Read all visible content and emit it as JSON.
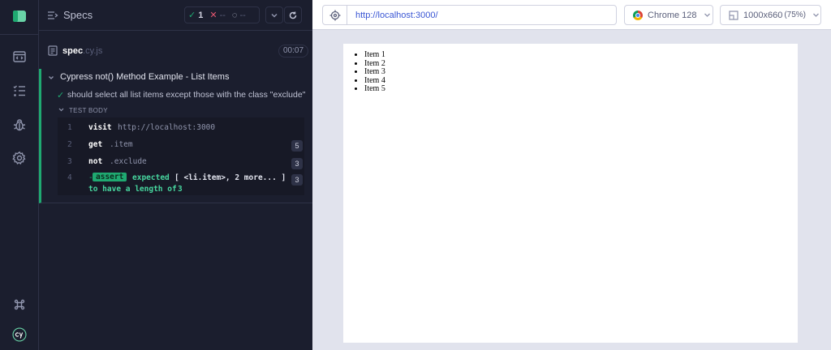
{
  "rail": {
    "items": [
      "specs-nav",
      "runs-nav",
      "debug-nav",
      "settings-nav"
    ]
  },
  "header": {
    "title": "Specs",
    "passed": "1",
    "failed": "--",
    "pending": "--"
  },
  "spec": {
    "name": "spec",
    "ext": ".cy.js",
    "duration": "00:07"
  },
  "suite": {
    "title": "Cypress not() Method Example - List Items",
    "test_title": "should select all list items except those with the class \"exclude\"",
    "body_label": "TEST BODY"
  },
  "commands": [
    {
      "num": "1",
      "name": "visit",
      "arg": "http://localhost:3000",
      "count": ""
    },
    {
      "num": "2",
      "name": "get",
      "arg": ".item",
      "count": "5"
    },
    {
      "num": "3",
      "name": "not",
      "arg": ".exclude",
      "count": "3"
    },
    {
      "num": "4",
      "name": "assert",
      "arg_line1_a": "expected",
      "arg_line1_b": "[ <li.item>, 2 more... ]",
      "arg_line2_a": "to have a length of",
      "arg_line2_b": "3",
      "count": "3"
    }
  ],
  "aut": {
    "url": "http://localhost:3000/",
    "browser": "Chrome 128",
    "viewport": "1000x660",
    "zoom": "(75%)",
    "list_items": [
      "Item 1",
      "Item 2",
      "Item 3",
      "Item 4",
      "Item 5"
    ]
  },
  "colors": {
    "pass": "#1fa971",
    "fail": "#e45770",
    "link": "#3a56d4"
  }
}
